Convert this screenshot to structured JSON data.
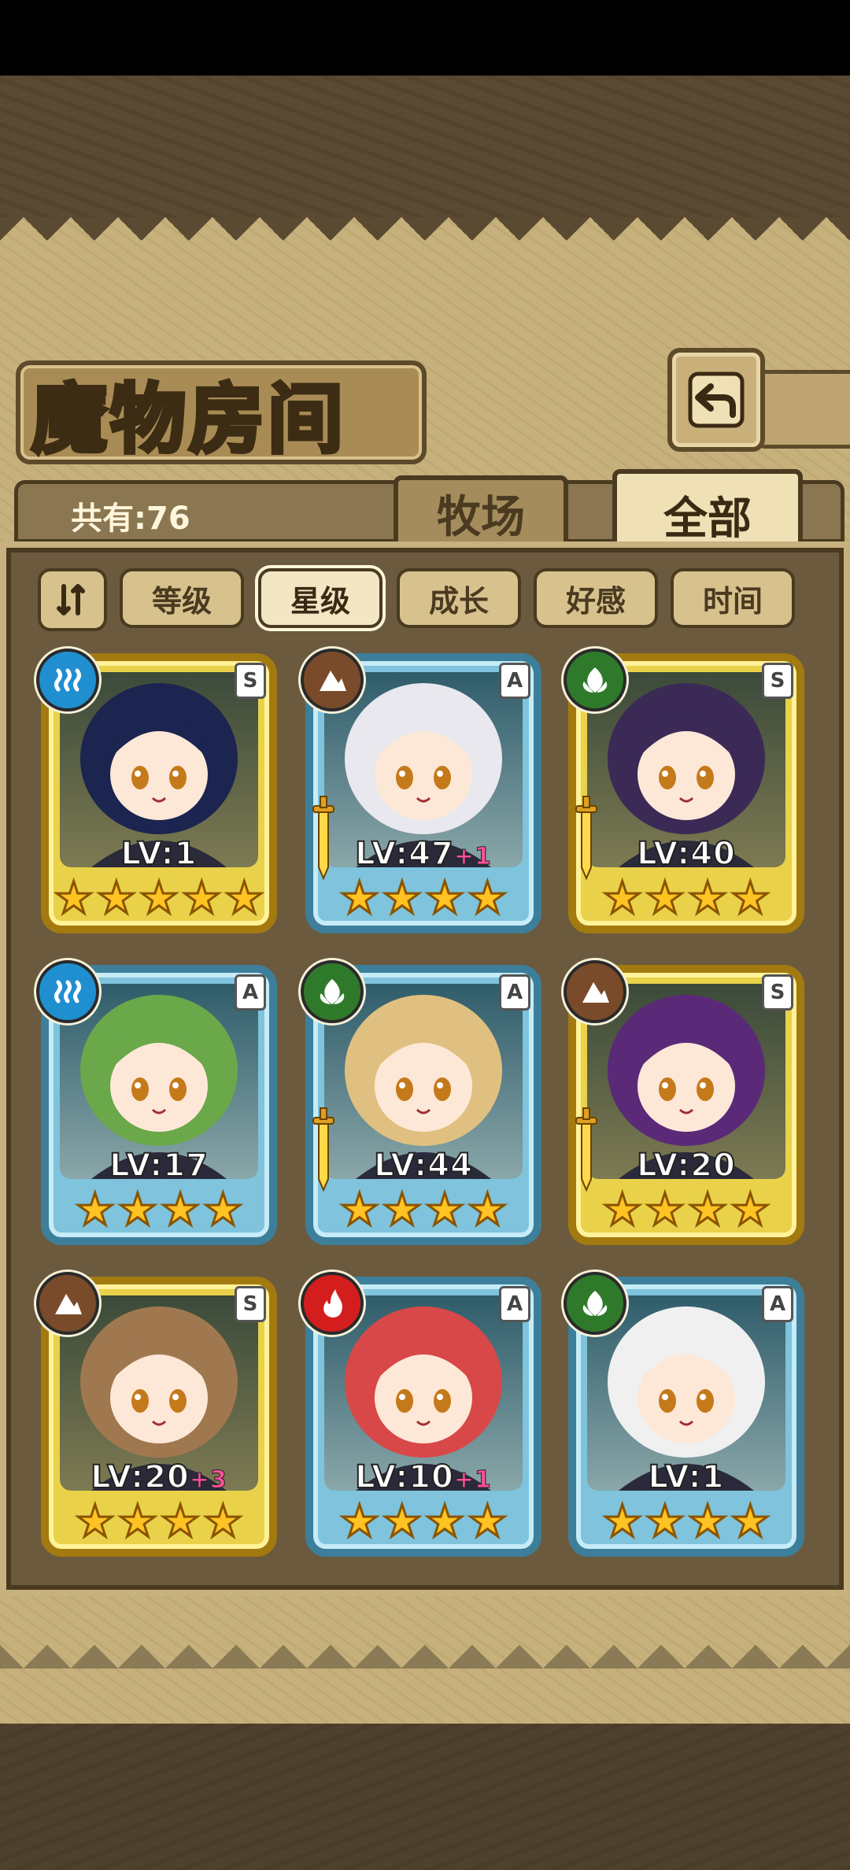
{
  "header": {
    "title": "魔物房间",
    "count_label": "共有:76"
  },
  "tabs": [
    {
      "label": "牧场",
      "active": false
    },
    {
      "label": "全部",
      "active": true
    }
  ],
  "filters": [
    {
      "label": "等级",
      "active": false
    },
    {
      "label": "星级",
      "active": true
    },
    {
      "label": "成长",
      "active": false
    },
    {
      "label": "好感",
      "active": false
    },
    {
      "label": "时间",
      "active": false
    }
  ],
  "colors": {
    "gold_frame": "#e9d24a",
    "blue_frame": "#7fc3dc",
    "water": "#1f8fd0",
    "earth": "#7a4b2a",
    "nature": "#2f7a2a",
    "fire": "#d41e1e"
  },
  "monsters": [
    {
      "level": "LV:1",
      "bonus": "",
      "rank": "S",
      "frame": "gold",
      "element": "water",
      "stars": 5,
      "weapon": false
    },
    {
      "level": "LV:47",
      "bonus": "+1",
      "rank": "A",
      "frame": "blue",
      "element": "earth",
      "stars": 4,
      "weapon": true
    },
    {
      "level": "LV:40",
      "bonus": "",
      "rank": "S",
      "frame": "gold",
      "element": "nature",
      "stars": 4,
      "weapon": true
    },
    {
      "level": "LV:17",
      "bonus": "",
      "rank": "A",
      "frame": "blue",
      "element": "water",
      "stars": 4,
      "weapon": false
    },
    {
      "level": "LV:44",
      "bonus": "",
      "rank": "A",
      "frame": "blue",
      "element": "nature",
      "stars": 4,
      "weapon": true
    },
    {
      "level": "LV:20",
      "bonus": "",
      "rank": "S",
      "frame": "gold",
      "element": "earth",
      "stars": 4,
      "weapon": true
    },
    {
      "level": "LV:20",
      "bonus": "+3",
      "rank": "S",
      "frame": "gold",
      "element": "earth",
      "stars": 4,
      "weapon": false
    },
    {
      "level": "LV:10",
      "bonus": "+1",
      "rank": "A",
      "frame": "blue",
      "element": "fire",
      "stars": 4,
      "weapon": false
    },
    {
      "level": "LV:1",
      "bonus": "",
      "rank": "A",
      "frame": "blue",
      "element": "nature",
      "stars": 4,
      "weapon": false
    }
  ]
}
